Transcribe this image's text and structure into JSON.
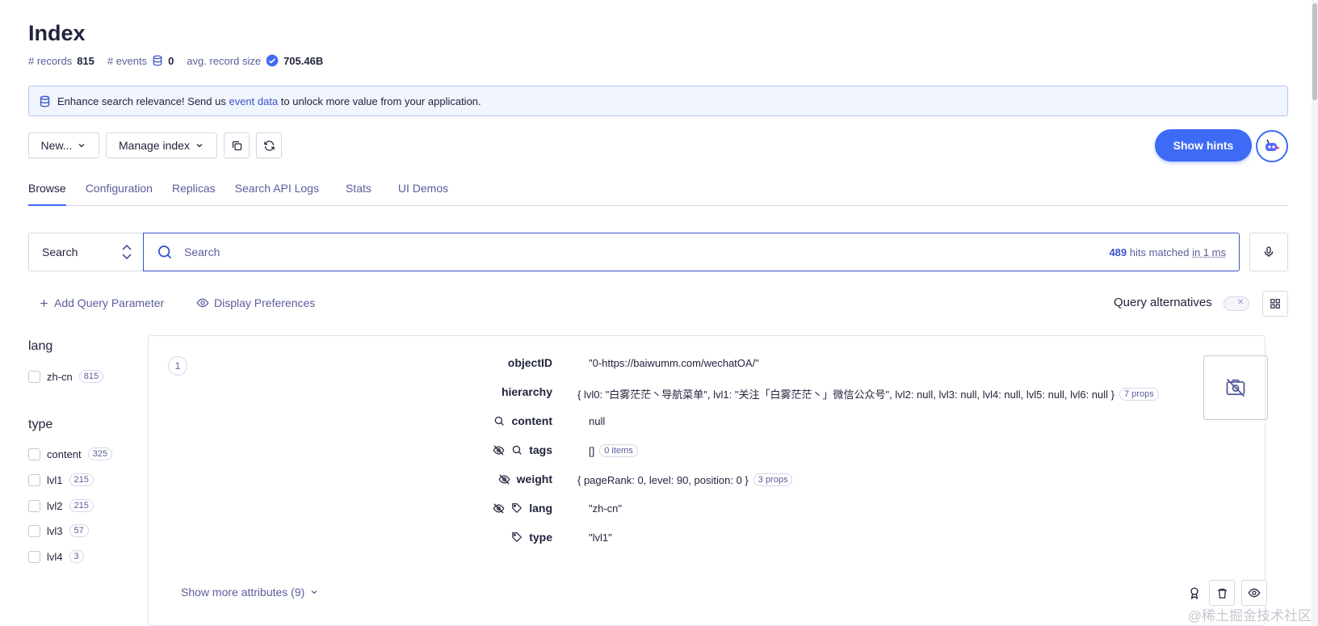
{
  "page": {
    "title": "Index",
    "stats": {
      "records_label": "# records",
      "records_value": "815",
      "events_label": "# events",
      "events_value": "0",
      "size_label": "avg. record size",
      "size_value": "705.46B"
    },
    "banner": {
      "text_before": "Enhance search relevance! Send us ",
      "link": "event data",
      "text_after": " to unlock more value from your application."
    }
  },
  "toolbar": {
    "new_label": "New...",
    "manage_label": "Manage index",
    "hints_label": "Show hints"
  },
  "tabs": [
    {
      "label": "Browse",
      "active": true
    },
    {
      "label": "Configuration",
      "active": false
    },
    {
      "label": "Replicas",
      "active": false
    },
    {
      "label": "Search API Logs",
      "active": false
    },
    {
      "label": "Stats",
      "active": false
    },
    {
      "label": "UI Demos",
      "active": false
    }
  ],
  "search": {
    "mode_label": "Search",
    "placeholder": "Search",
    "hits_count": "489",
    "hits_text": "hits matched",
    "time_text": "in 1 ms"
  },
  "query": {
    "add_param": "Add Query Parameter",
    "display_prefs": "Display Preferences",
    "alternatives": "Query alternatives"
  },
  "facets": [
    {
      "title": "lang",
      "items": [
        {
          "label": "zh-cn",
          "count": "815"
        }
      ]
    },
    {
      "title": "type",
      "items": [
        {
          "label": "content",
          "count": "325"
        },
        {
          "label": "lvl1",
          "count": "215"
        },
        {
          "label": "lvl2",
          "count": "215"
        },
        {
          "label": "lvl3",
          "count": "57"
        },
        {
          "label": "lvl4",
          "count": "3"
        }
      ]
    }
  ],
  "record": {
    "rank": "1",
    "attributes": [
      {
        "name": "objectID",
        "value": "\"0-https://baiwumm.com/wechatOA/\"",
        "pill": "",
        "icons": []
      },
      {
        "name": "hierarchy",
        "value": "{ lvl0: \"白雾茫茫丶导航菜单\", lvl1: \"关注「白雾茫茫丶」微信公众号\", lvl2: null, lvl3: null, lvl4: null, lvl5: null, lvl6: null }",
        "pill": "7 props",
        "icons": []
      },
      {
        "name": "content",
        "value": "null",
        "pill": "",
        "icons": [
          "search-icon"
        ]
      },
      {
        "name": "tags",
        "value": "[]",
        "pill": "0 items",
        "icons": [
          "eye-off-icon",
          "search-icon"
        ]
      },
      {
        "name": "weight",
        "value": "{ pageRank: 0, level: 90, position: 0 }",
        "pill": "3 props",
        "icons": [
          "eye-off-icon"
        ]
      },
      {
        "name": "lang",
        "value": "\"zh-cn\"",
        "pill": "",
        "icons": [
          "eye-off-icon",
          "tag-icon"
        ]
      },
      {
        "name": "type",
        "value": "\"lvl1\"",
        "pill": "",
        "icons": [
          "tag-icon"
        ]
      }
    ],
    "show_more": "Show more attributes (9)"
  },
  "watermark": "@稀土掘金技术社区",
  "colors": {
    "accent": "#3e6bf5",
    "link": "#3a55c9",
    "text": "#21243d",
    "muted": "#5a5e9a",
    "banner_bg": "#f1f5fe"
  }
}
